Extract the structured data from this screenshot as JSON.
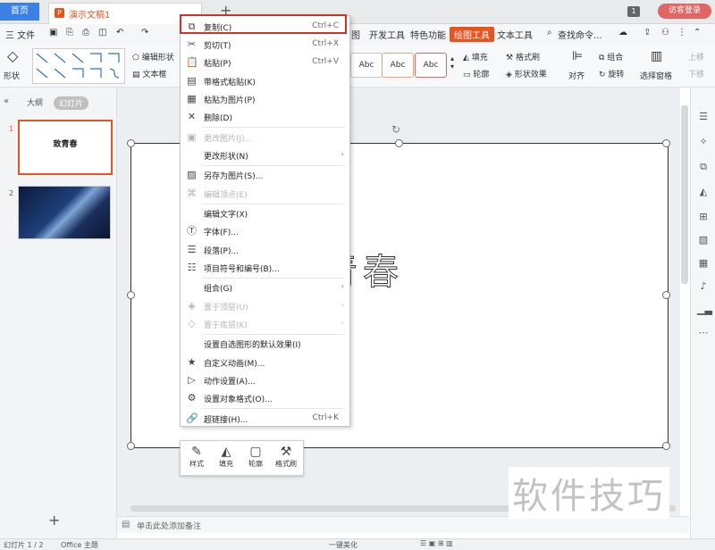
{
  "tabs": {
    "home": "首页",
    "doc": "演示文稿1",
    "doc_badge": "P",
    "new_tab": "+"
  },
  "titlebar_right": {
    "badge": "1",
    "login": "访客登录"
  },
  "menubar": {
    "file": "三 文件",
    "items": [
      "图",
      "开发工具",
      "特色功能",
      "绘图工具",
      "文本工具"
    ],
    "active": "绘图工具",
    "search": "查找命令..."
  },
  "toolbar": {
    "shape": "形状",
    "edit_shape": "编辑形状",
    "text_box": "文本框",
    "style_samples": [
      "Abc",
      "Abc",
      "Abc",
      "Abc"
    ],
    "fill": "填充",
    "outline": "轮廓",
    "format_brush": "格式刷",
    "shape_effect": "形状效果",
    "align": "对齐",
    "group": "组合",
    "rotate": "旋转",
    "selection_pane": "选择窗格",
    "move_up": "上移",
    "move_down": "下移"
  },
  "left_panel": {
    "outline_tab": "大纲",
    "slides_tab": "幻灯片",
    "slide1_num": "1",
    "slide1_text": "致青春",
    "slide2_num": "2",
    "add": "+"
  },
  "slide": {
    "title": "致青春",
    "title_visible": "青春"
  },
  "context_menu": {
    "items": [
      {
        "icon": "⧉",
        "label": "复制(C)",
        "shortcut": "Ctrl+C",
        "disabled": false
      },
      {
        "icon": "✂",
        "label": "剪切(T)",
        "shortcut": "Ctrl+X",
        "disabled": false
      },
      {
        "icon": "📋",
        "label": "粘贴(P)",
        "shortcut": "Ctrl+V",
        "disabled": false
      },
      {
        "icon": "▤",
        "label": "带格式粘贴(K)",
        "shortcut": "",
        "disabled": false
      },
      {
        "icon": "▦",
        "label": "粘贴为图片(P)",
        "shortcut": "",
        "disabled": false
      },
      {
        "icon": "✕",
        "label": "删除(D)",
        "shortcut": "",
        "disabled": false
      },
      {
        "icon": "▣",
        "label": "更改图片(J)...",
        "shortcut": "",
        "disabled": true
      },
      {
        "icon": "",
        "label": "更改形状(N)",
        "shortcut": "",
        "disabled": false,
        "submenu": true
      },
      {
        "icon": "▨",
        "label": "另存为图片(S)...",
        "shortcut": "",
        "disabled": false
      },
      {
        "icon": "⌘",
        "label": "编辑顶点(E)",
        "shortcut": "",
        "disabled": true
      },
      {
        "icon": "",
        "label": "编辑文字(X)",
        "shortcut": "",
        "disabled": false
      },
      {
        "icon": "Ⓣ",
        "label": "字体(F)...",
        "shortcut": "",
        "disabled": false
      },
      {
        "icon": "☰",
        "label": "段落(P)...",
        "shortcut": "",
        "disabled": false
      },
      {
        "icon": "☷",
        "label": "项目符号和编号(B)...",
        "shortcut": "",
        "disabled": false
      },
      {
        "icon": "",
        "label": "组合(G)",
        "shortcut": "",
        "disabled": false,
        "submenu": true
      },
      {
        "icon": "◈",
        "label": "置于顶层(U)",
        "shortcut": "",
        "disabled": true,
        "submenu": true
      },
      {
        "icon": "◇",
        "label": "置于底层(K)",
        "shortcut": "",
        "disabled": true,
        "submenu": true
      },
      {
        "icon": "",
        "label": "设置自选图形的默认效果(I)",
        "shortcut": "",
        "disabled": false
      },
      {
        "icon": "★",
        "label": "自定义动画(M)...",
        "shortcut": "",
        "disabled": false
      },
      {
        "icon": "▷",
        "label": "动作设置(A)...",
        "shortcut": "",
        "disabled": false
      },
      {
        "icon": "⚙",
        "label": "设置对象格式(O)...",
        "shortcut": "",
        "disabled": false
      },
      {
        "icon": "🔗",
        "label": "超链接(H)...",
        "shortcut": "Ctrl+K",
        "disabled": false
      }
    ]
  },
  "mini_toolbar": {
    "style": "样式",
    "fill": "填充",
    "outline": "轮廓",
    "brush": "格式刷"
  },
  "notes": {
    "placeholder": "单击此处添加备注"
  },
  "statusbar": {
    "slide_info": "幻灯片 1 / 2",
    "theme": "Office 主题",
    "beautify": "一键美化"
  },
  "watermark": "软件技巧"
}
